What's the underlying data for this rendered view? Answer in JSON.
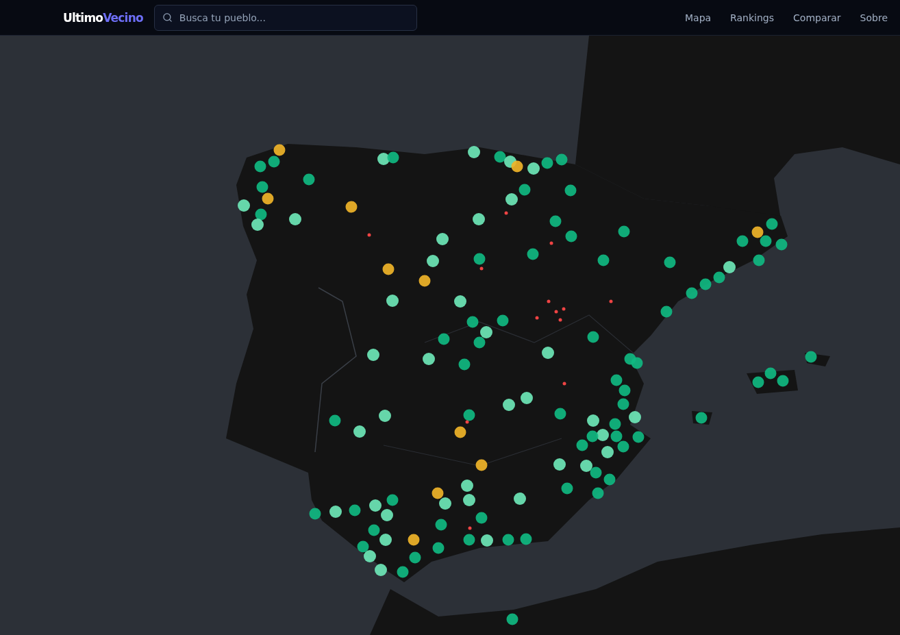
{
  "logo": [
    "Ultimo",
    "Vecino"
  ],
  "search": {
    "placeholder": "Busca tu pueblo..."
  },
  "nav": [
    {
      "label": "Mapa"
    },
    {
      "label": "Rankings"
    },
    {
      "label": "Comparar"
    },
    {
      "label": "Sobre"
    }
  ]
}
